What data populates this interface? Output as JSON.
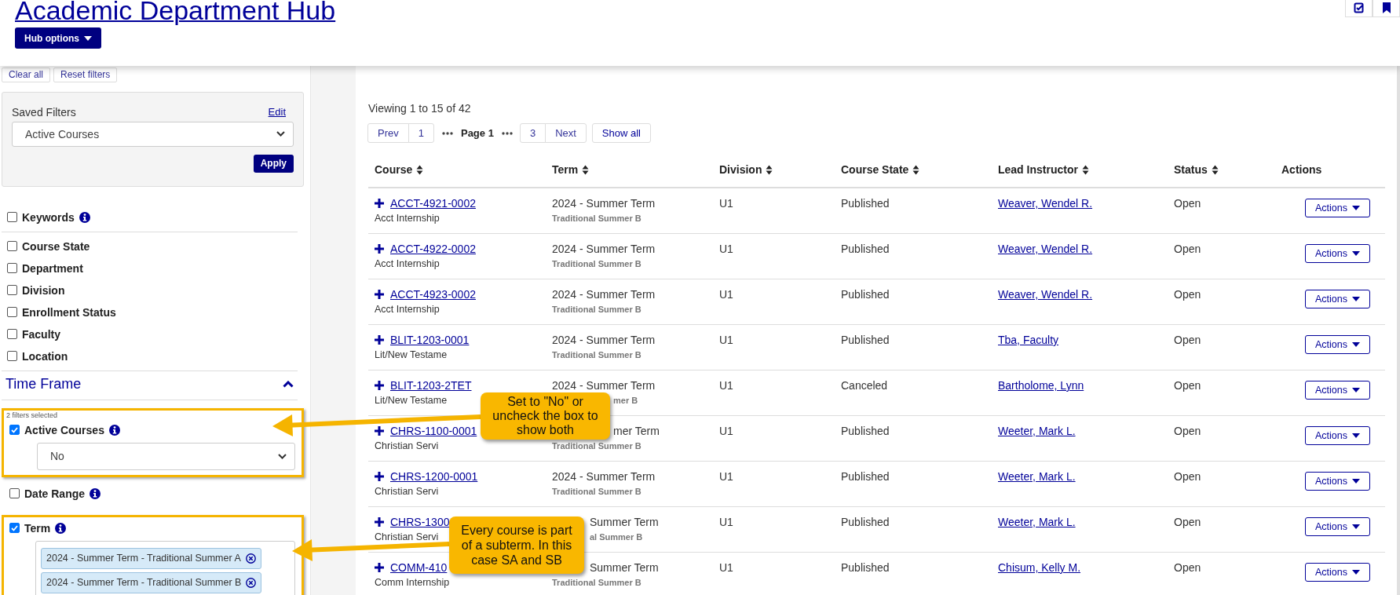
{
  "header": {
    "title": "Academic Department Hub",
    "menu_button": "Hub options"
  },
  "sidebar": {
    "clear_all": "Clear all",
    "reset": "Reset filters",
    "saved": {
      "label": "Saved Filters",
      "edit": "Edit",
      "value": "Active Courses",
      "apply": "Apply"
    },
    "filter_groups": [
      [
        {
          "label": "Keywords",
          "checked": false,
          "info": true
        }
      ],
      [
        {
          "label": "Course State",
          "checked": false,
          "info": false
        },
        {
          "label": "Department",
          "checked": false,
          "info": false
        },
        {
          "label": "Division",
          "checked": false,
          "info": false
        },
        {
          "label": "Enrollment Status",
          "checked": false,
          "info": false
        },
        {
          "label": "Faculty",
          "checked": false,
          "info": false
        },
        {
          "label": "Location",
          "checked": false,
          "info": false
        }
      ]
    ],
    "time_frame": {
      "title": "Time Frame",
      "expanded": true,
      "items": [
        {
          "kind": "select",
          "label": "Active Courses",
          "checked": true,
          "info": true,
          "highlighted": true,
          "note": "2 filters selected",
          "value": "No"
        },
        {
          "kind": "plain",
          "label": "Date Range",
          "checked": false,
          "info": true,
          "highlighted": false
        },
        {
          "kind": "tags",
          "label": "Term",
          "checked": true,
          "info": true,
          "highlighted": true,
          "tags": [
            "2024 - Summer Term - Traditional Summer A",
            "2024 - Summer Term - Traditional Summer B"
          ]
        }
      ]
    }
  },
  "main": {
    "viewing": "Viewing 1 to 15 of 42",
    "pager": [
      {
        "kind": "group",
        "buttons": [
          "Prev",
          "1"
        ]
      },
      {
        "kind": "dots"
      },
      {
        "kind": "current",
        "label": "Page 1"
      },
      {
        "kind": "dots"
      },
      {
        "kind": "group",
        "buttons": [
          "3",
          "Next"
        ]
      },
      {
        "kind": "button",
        "label": "Show all"
      }
    ],
    "table": {
      "columns": [
        {
          "label": "Course",
          "sortable": true
        },
        {
          "label": "Term",
          "sortable": true
        },
        {
          "label": "Division",
          "sortable": true
        },
        {
          "label": "Course State",
          "sortable": true
        },
        {
          "label": "Lead Instructor",
          "sortable": true
        },
        {
          "label": "Status",
          "sortable": true
        },
        {
          "label": "Actions",
          "sortable": false
        }
      ],
      "rows": [
        {
          "course": "ACCT-4921-0002",
          "title": "Acct Internship",
          "term": "2024 - Summer Term",
          "subterm": "Traditional Summer B",
          "division": "U1",
          "state": "Published",
          "instructor": "Weaver, Wendel R.",
          "status": "Open",
          "action": "Actions"
        },
        {
          "course": "ACCT-4922-0002",
          "title": "Acct Internship",
          "term": "2024 - Summer Term",
          "subterm": "Traditional Summer B",
          "division": "U1",
          "state": "Published",
          "instructor": "Weaver, Wendel R.",
          "status": "Open",
          "action": "Actions"
        },
        {
          "course": "ACCT-4923-0002",
          "title": "Acct Internship",
          "term": "2024 - Summer Term",
          "subterm": "Traditional Summer B",
          "division": "U1",
          "state": "Published",
          "instructor": "Weaver, Wendel R.",
          "status": "Open",
          "action": "Actions"
        },
        {
          "course": "BLIT-1203-0001",
          "title": "Lit/New Testame",
          "term": "2024 - Summer Term",
          "subterm": "Traditional Summer B",
          "division": "U1",
          "state": "Published",
          "instructor": "Tba, Faculty",
          "status": "Open",
          "action": "Actions"
        },
        {
          "course": "BLIT-1203-2TET",
          "title": "Lit/New Testame",
          "term": "2024 - Summer Term",
          "subterm": "mer B",
          "division": "U1",
          "state": "Canceled",
          "instructor": "Bartholome, Lynn",
          "status": "Open",
          "action": "Actions"
        },
        {
          "course": "CHRS-1100-0001",
          "title": "Christian Servi",
          "term": "mer Term",
          "subterm": "Traditional Summer B",
          "division": "U1",
          "state": "Published",
          "instructor": "Weeter, Mark L.",
          "status": "Open",
          "action": "Actions"
        },
        {
          "course": "CHRS-1200-0001",
          "title": "Christian Servi",
          "term": "2024 - Summer Term",
          "subterm": "Traditional Summer B",
          "division": "U1",
          "state": "Published",
          "instructor": "Weeter, Mark L.",
          "status": "Open",
          "action": "Actions"
        },
        {
          "course": "CHRS-1300",
          "title": "Christian Servi",
          "term": "Summer Term",
          "subterm": "al Summer B",
          "division": "U1",
          "state": "Published",
          "instructor": "Weeter, Mark L.",
          "status": "Open",
          "action": "Actions"
        },
        {
          "course": "COMM-410",
          "title": "Comm Internship",
          "term": "Summer Term",
          "subterm": "Traditional Summer B",
          "division": "U1",
          "state": "Published",
          "instructor": "Chisum, Kelly M.",
          "status": "Open",
          "action": "Actions"
        }
      ]
    }
  },
  "callouts": [
    {
      "text": "Set to \"No\" or uncheck the box to show both"
    },
    {
      "text": "Every course is part of a subterm. In this case SA and SB"
    }
  ]
}
